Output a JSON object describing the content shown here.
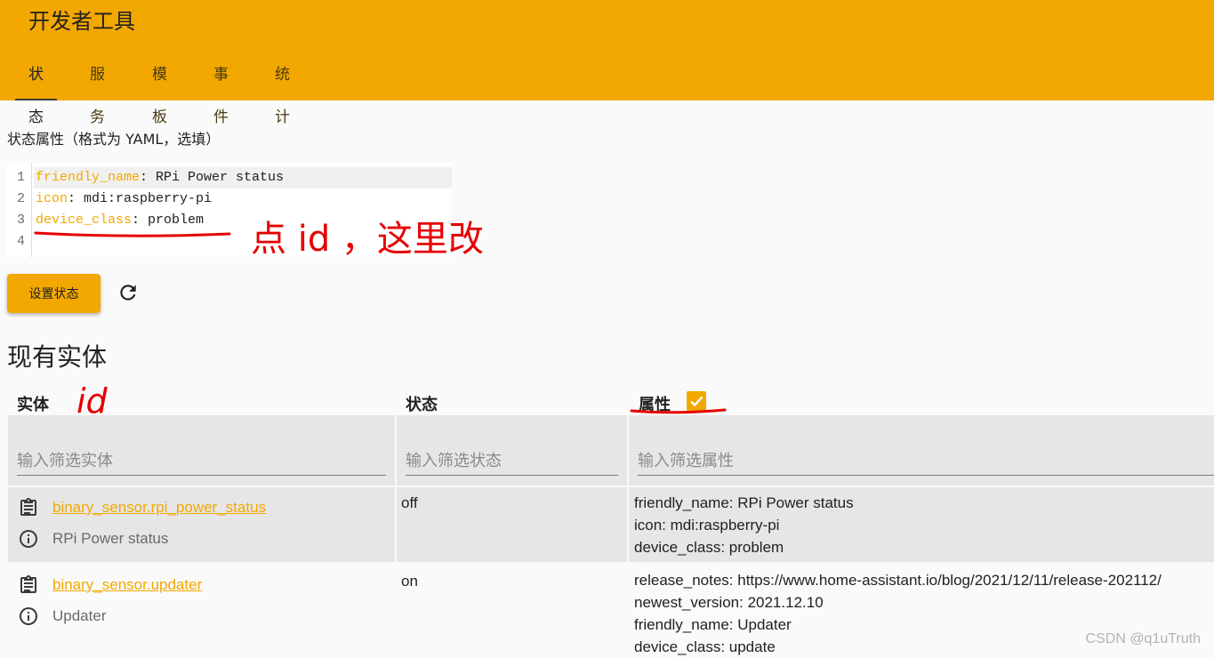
{
  "header": {
    "title": "开发者工具",
    "tabs": [
      "状态",
      "服务",
      "模板",
      "事件",
      "统计"
    ],
    "active_tab": "状态"
  },
  "state_form": {
    "attributes_label": "状态属性（格式为 YAML，选填）",
    "editor_lines": [
      {
        "num": "1",
        "key": "friendly_name",
        "value": ": RPi Power status"
      },
      {
        "num": "2",
        "key": "icon",
        "value": ": mdi:raspberry-pi"
      },
      {
        "num": "3",
        "key": "device_class",
        "value": ": problem"
      },
      {
        "num": "4",
        "key": "",
        "value": ""
      }
    ],
    "set_state_button": "设置状态",
    "refresh_icon": "refresh-icon"
  },
  "entities": {
    "section_title": "现有实体",
    "columns": {
      "entity": "实体",
      "state": "状态",
      "attributes": "属性"
    },
    "attributes_checkbox_checked": true,
    "filters": {
      "entity_placeholder": "输入筛选实体",
      "state_placeholder": "输入筛选状态",
      "attributes_placeholder": "输入筛选属性"
    },
    "rows": [
      {
        "entity_id": "binary_sensor.rpi_power_status",
        "name": "RPi Power status",
        "state": "off",
        "attributes": [
          "friendly_name: RPi Power status",
          "icon: mdi:raspberry-pi",
          "device_class: problem"
        ]
      },
      {
        "entity_id": "binary_sensor.updater",
        "name": "Updater",
        "state": "on",
        "attributes": [
          "release_notes: https://www.home-assistant.io/blog/2021/12/11/release-202112/",
          "newest_version: 2021.12.10",
          "friendly_name: Updater",
          "device_class: update"
        ]
      }
    ]
  },
  "annotations": {
    "editor_note": "点 id ，这里改",
    "entity_note": "id"
  },
  "watermark": "CSDN @q1uTruth",
  "colors": {
    "accent": "#f2a800",
    "annotation": "#e60000"
  }
}
